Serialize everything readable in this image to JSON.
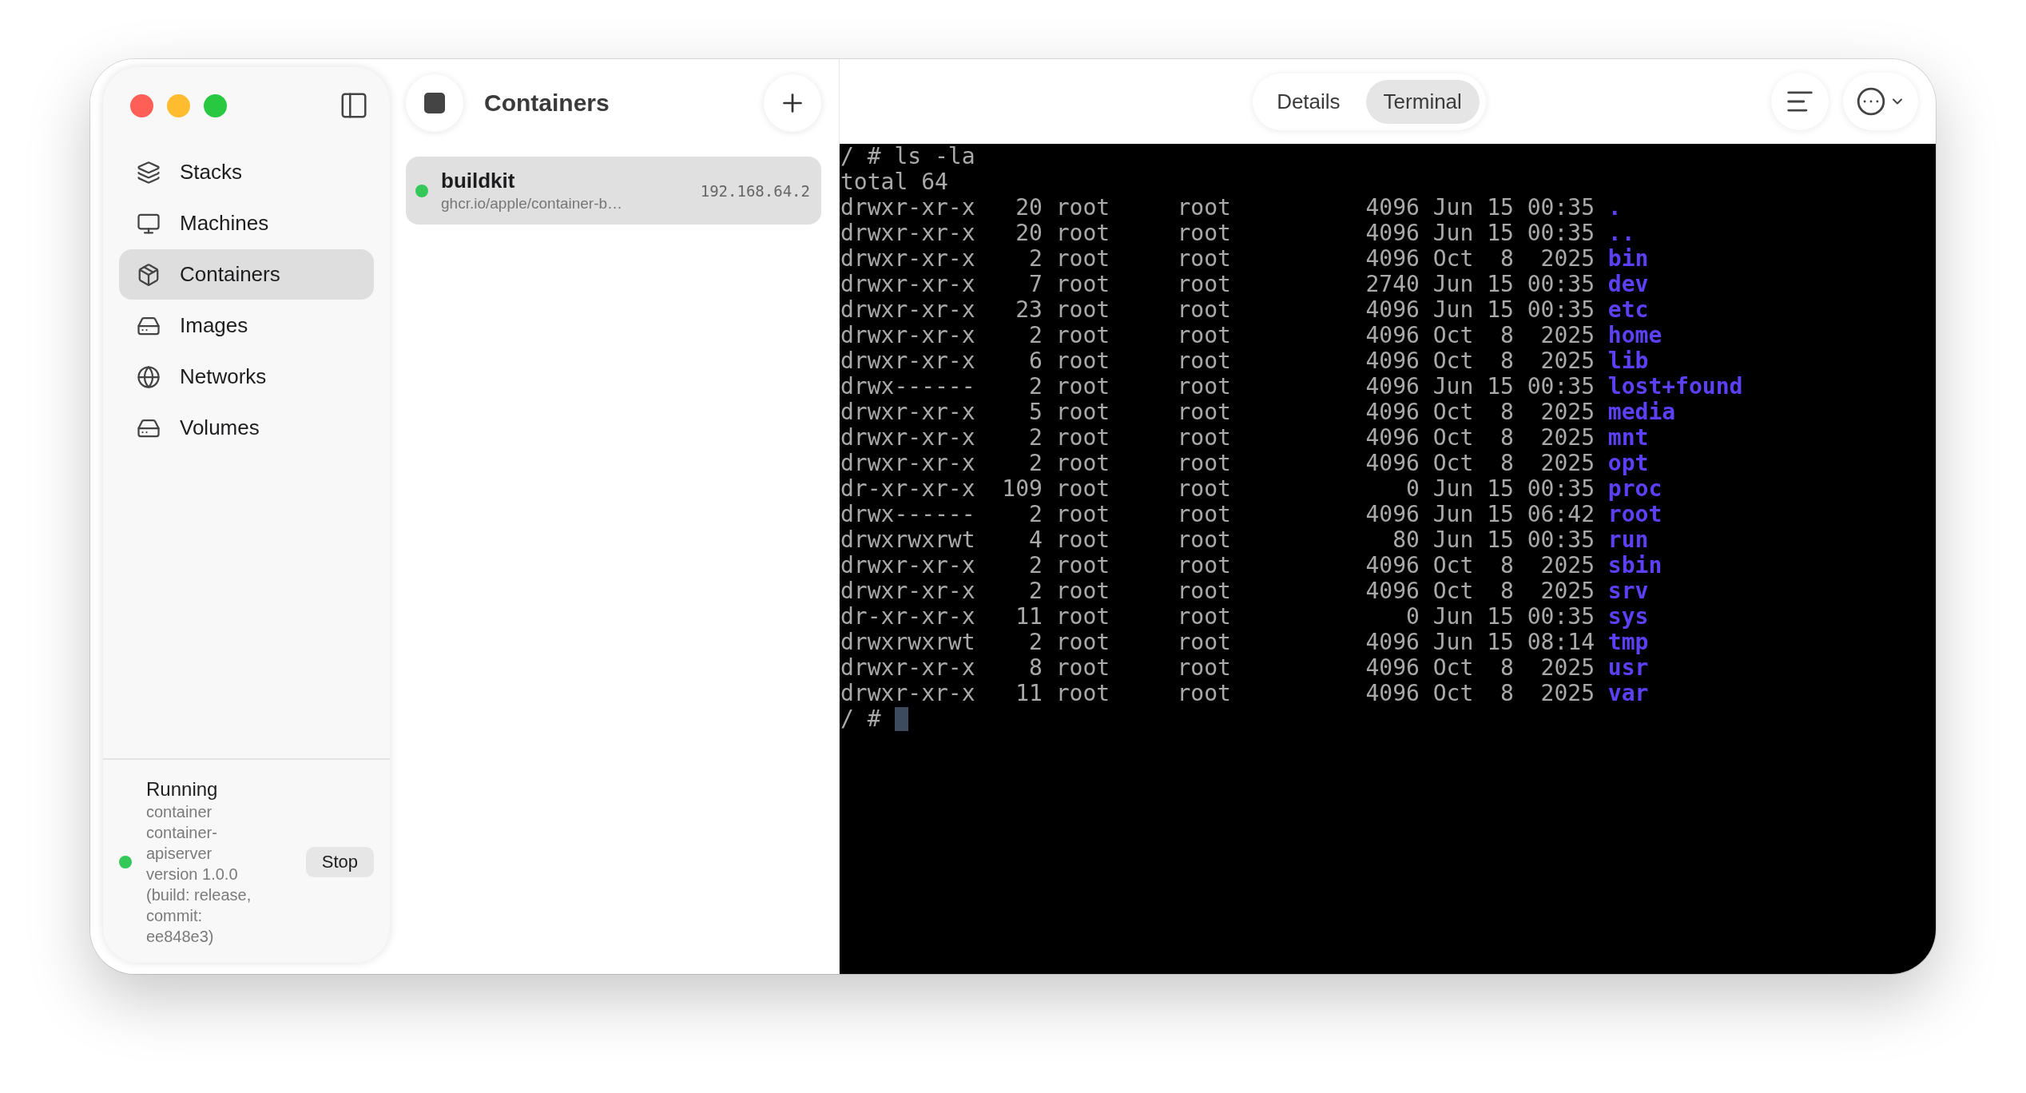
{
  "sidebar": {
    "items": [
      {
        "label": "Stacks",
        "kind": "stacks",
        "selected": false
      },
      {
        "label": "Machines",
        "kind": "machines",
        "selected": false
      },
      {
        "label": "Containers",
        "kind": "containers",
        "selected": true
      },
      {
        "label": "Images",
        "kind": "images",
        "selected": false
      },
      {
        "label": "Networks",
        "kind": "networks",
        "selected": false
      },
      {
        "label": "Volumes",
        "kind": "volumes",
        "selected": false
      }
    ],
    "status": {
      "title": "Running",
      "detail": "container container-apiserver version 1.0.0 (build: release, commit: ee848e3)",
      "button": "Stop"
    }
  },
  "list": {
    "title": "Containers",
    "items": [
      {
        "name": "buildkit",
        "image": "ghcr.io/apple/container-b…",
        "address": "192.168.64.2",
        "color": "#34c759",
        "selected": true
      }
    ]
  },
  "tabs": [
    {
      "label": "Details",
      "selected": false
    },
    {
      "label": "Terminal",
      "selected": true
    }
  ],
  "terminal": {
    "lines": [
      {
        "text": "/ # ls -la"
      },
      {
        "text": "total 64"
      },
      {
        "text": "drwxr-xr-x   20 root     root          4096 Jun 15 00:35",
        "name": "."
      },
      {
        "text": "drwxr-xr-x   20 root     root          4096 Jun 15 00:35",
        "name": ".."
      },
      {
        "text": "drwxr-xr-x    2 root     root          4096 Oct  8  2025",
        "name": "bin"
      },
      {
        "text": "drwxr-xr-x    7 root     root          2740 Jun 15 00:35",
        "name": "dev"
      },
      {
        "text": "drwxr-xr-x   23 root     root          4096 Jun 15 00:35",
        "name": "etc"
      },
      {
        "text": "drwxr-xr-x    2 root     root          4096 Oct  8  2025",
        "name": "home"
      },
      {
        "text": "drwxr-xr-x    6 root     root          4096 Oct  8  2025",
        "name": "lib"
      },
      {
        "text": "drwx------    2 root     root          4096 Jun 15 00:35",
        "name": "lost+found"
      },
      {
        "text": "drwxr-xr-x    5 root     root          4096 Oct  8  2025",
        "name": "media"
      },
      {
        "text": "drwxr-xr-x    2 root     root          4096 Oct  8  2025",
        "name": "mnt"
      },
      {
        "text": "drwxr-xr-x    2 root     root          4096 Oct  8  2025",
        "name": "opt"
      },
      {
        "text": "dr-xr-xr-x  109 root     root             0 Jun 15 00:35",
        "name": "proc"
      },
      {
        "text": "drwx------    2 root     root          4096 Jun 15 06:42",
        "name": "root"
      },
      {
        "text": "drwxrwxrwt    4 root     root            80 Jun 15 00:35",
        "name": "run"
      },
      {
        "text": "drwxr-xr-x    2 root     root          4096 Oct  8  2025",
        "name": "sbin"
      },
      {
        "text": "drwxr-xr-x    2 root     root          4096 Oct  8  2025",
        "name": "srv"
      },
      {
        "text": "dr-xr-xr-x   11 root     root             0 Jun 15 00:35",
        "name": "sys"
      },
      {
        "text": "drwxrwxrwt    2 root     root          4096 Jun 15 08:14",
        "name": "tmp"
      },
      {
        "text": "drwxr-xr-x    8 root     root          4096 Oct  8  2025",
        "name": "usr"
      },
      {
        "text": "drwxr-xr-x   11 root     root          4096 Oct  8  2025",
        "name": "var"
      }
    ],
    "prompt": "/ #"
  }
}
